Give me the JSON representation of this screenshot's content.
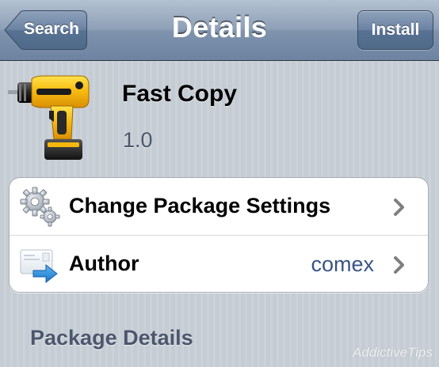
{
  "navbar": {
    "title": "Details",
    "back_label": "Search",
    "action_label": "Install"
  },
  "package": {
    "name": "Fast Copy",
    "version": "1.0",
    "icon": "drill-icon"
  },
  "rows": [
    {
      "label": "Change Package Settings",
      "value": "",
      "icon": "gears-icon"
    },
    {
      "label": "Author",
      "value": "comex",
      "icon": "author-card-icon"
    }
  ],
  "section": {
    "title": "Package Details"
  },
  "watermark": "AddictiveTips",
  "colors": {
    "navbar": "#7f93ad",
    "background": "#c5ccd4",
    "value_text": "#385487",
    "section_text": "#4c566c"
  }
}
